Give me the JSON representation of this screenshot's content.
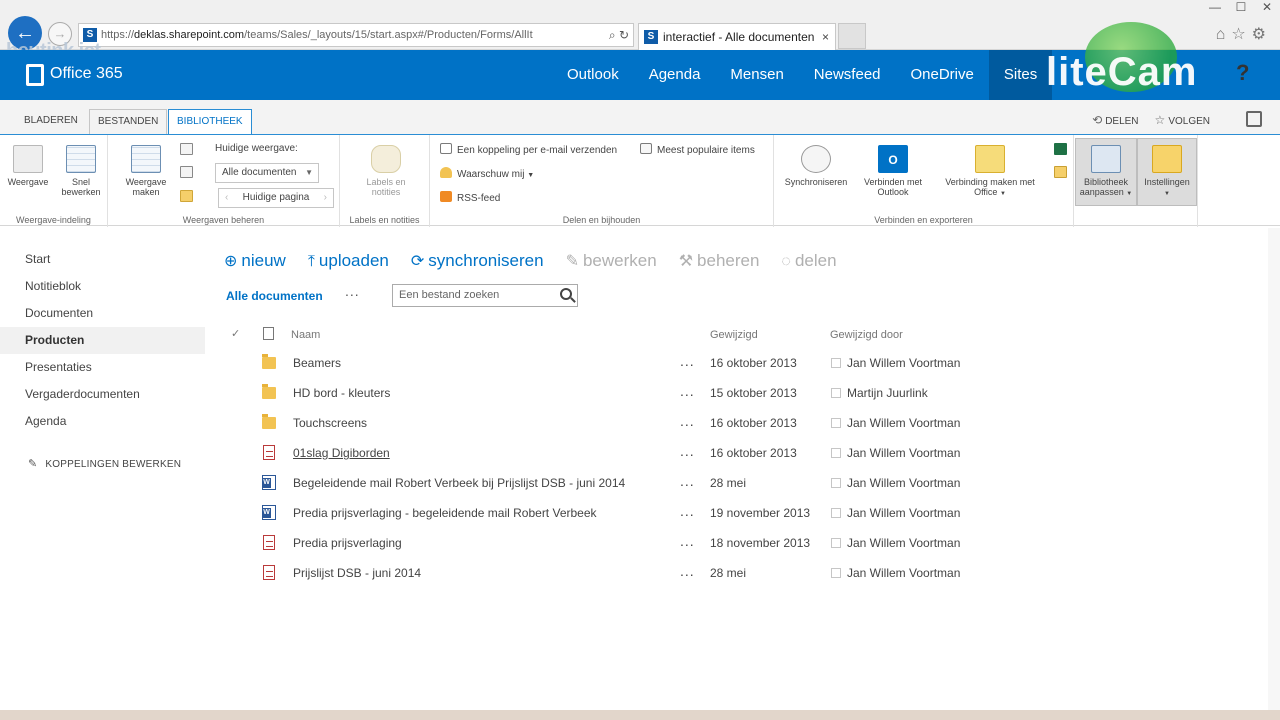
{
  "browser": {
    "url_prefix": "https://",
    "url_host": "deklas.sharepoint.com",
    "url_path": "/teams/Sales/_layouts/15/start.aspx#/Producten/Forms/AllIt",
    "tab_title": "interactief - Alle documenten",
    "tab_close": "×",
    "win_min": "—",
    "win_max": "☐",
    "win_close": "✕"
  },
  "watermarks": {
    "heutink": "heutink ict",
    "litecam": "liteCam"
  },
  "suite": {
    "brand": "Office 365",
    "nav": [
      "Outlook",
      "Agenda",
      "Mensen",
      "Newsfeed",
      "OneDrive",
      "Sites"
    ],
    "help": "?"
  },
  "ribbon_tabs": {
    "bladeren": "BLADEREN",
    "bestanden": "BESTANDEN",
    "bibliotheek": "BIBLIOTHEEK",
    "share": "DELEN",
    "follow": "VOLGEN"
  },
  "ribbon": {
    "group1": {
      "label": "Weergave-indeling",
      "weergave": "Weergave",
      "snel_bewerken": [
        "Snel",
        "bewerken"
      ]
    },
    "group2": {
      "label": "Weergaven beheren",
      "weergave_maken": [
        "Weergave",
        "maken"
      ],
      "current_view_label": "Huidige weergave:",
      "current_view_value": "Alle documenten",
      "current_page": "Huidige pagina"
    },
    "group3": {
      "label": "Labels en notities",
      "labels": [
        "Labels en",
        "notities"
      ]
    },
    "group4": {
      "label": "Delen en bijhouden",
      "email_link": "Een koppeling per e-mail verzenden",
      "alert_me": "Waarschuw mij",
      "rss": "RSS-feed",
      "popular": "Meest populaire items"
    },
    "group5": {
      "label": "Verbinden en exporteren",
      "sync": "Synchroniseren",
      "connect_outlook": [
        "Verbinden met",
        "Outlook"
      ],
      "connect_office": [
        "Verbinding maken met",
        "Office"
      ]
    },
    "group6": {
      "library_settings_btn": [
        "Bibliotheek",
        "aanpassen"
      ],
      "settings": "Instellingen"
    }
  },
  "leftnav": {
    "items": [
      "Start",
      "Notitieblok",
      "Documenten",
      "Producten",
      "Presentaties",
      "Vergaderdocumenten",
      "Agenda"
    ],
    "active": "Producten",
    "edit_links": "KOPPELINGEN BEWERKEN"
  },
  "commands": {
    "new": "nieuw",
    "upload": "uploaden",
    "sync": "synchroniseren",
    "edit": "bewerken",
    "manage": "beheren",
    "share": "delen",
    "icons": {
      "new": "⊕",
      "upload": "⤒",
      "sync": "⟳",
      "edit": "✎",
      "manage": "⚒",
      "share": "◌"
    }
  },
  "view": {
    "current": "Alle documenten",
    "more": "...",
    "search_placeholder": "Een bestand zoeken"
  },
  "table": {
    "check_glyph": "✓",
    "headers": {
      "name": "Naam",
      "modified": "Gewijzigd",
      "modified_by": "Gewijzigd door"
    },
    "rows": [
      {
        "type": "folder",
        "name": "Beamers",
        "modified": "16 oktober 2013",
        "by": "Jan Willem Voortman"
      },
      {
        "type": "folder",
        "name": "HD bord - kleuters",
        "modified": "15 oktober 2013",
        "by": "Martijn Juurlink"
      },
      {
        "type": "folder",
        "name": "Touchscreens",
        "modified": "16 oktober 2013",
        "by": "Jan Willem Voortman"
      },
      {
        "type": "pdf",
        "name": "01slag Digiborden",
        "modified": "16 oktober 2013",
        "by": "Jan Willem Voortman"
      },
      {
        "type": "word",
        "name": "Begeleidende mail Robert Verbeek bij Prijslijst DSB - juni 2014",
        "modified": "28 mei",
        "by": "Jan Willem Voortman"
      },
      {
        "type": "word",
        "name": "Predia prijsverlaging - begeleidende mail Robert Verbeek",
        "modified": "19 november 2013",
        "by": "Jan Willem Voortman"
      },
      {
        "type": "pdf",
        "name": "Predia prijsverlaging",
        "modified": "18 november 2013",
        "by": "Jan Willem Voortman"
      },
      {
        "type": "pdf",
        "name": "Prijslijst DSB - juni 2014",
        "modified": "28 mei",
        "by": "Jan Willem Voortman"
      }
    ],
    "row_menu": "..."
  },
  "colors": {
    "suite_blue": "#0072c6",
    "folder": "#f2c353",
    "pdf": "#b93a3a",
    "word": "#2b5797"
  }
}
